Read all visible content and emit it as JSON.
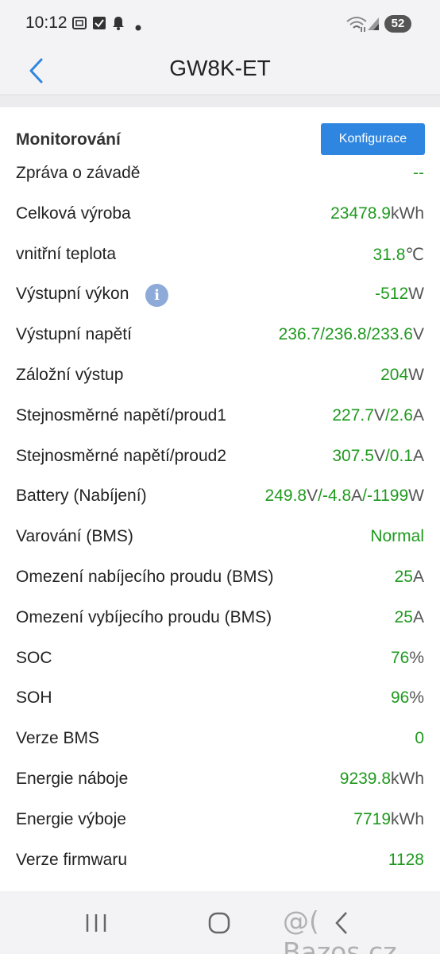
{
  "status_bar": {
    "time": "10:12",
    "battery": "52",
    "icons": [
      "screenshot-icon",
      "checkbox-icon",
      "bell-icon",
      "dot-icon",
      "wifi-icon",
      "signal-icon"
    ]
  },
  "header": {
    "title": "GW8K-ET",
    "back_icon": "chevron-left-icon"
  },
  "section": {
    "title": "Monitorování",
    "config_button": "Konfigurace"
  },
  "rows": [
    {
      "label": "Zpráva o závadě",
      "value": "--",
      "unit": ""
    },
    {
      "label": "Celková výroba",
      "value": "23478.9",
      "unit": "kWh"
    },
    {
      "label": "vnitřní teplota",
      "value": "31.8",
      "unit": "℃"
    },
    {
      "label": "Výstupní výkon",
      "value": "-512",
      "unit": "W",
      "info_icon": "i"
    },
    {
      "label": "Výstupní napětí",
      "value": "236.7/236.8/233.6",
      "unit": "V"
    },
    {
      "label": "Záložní výstup",
      "value": "204",
      "unit": "W"
    },
    {
      "label": "Stejnosměrné napětí/proud1",
      "value": "227.7",
      "unit": "V",
      "value2": "/2.6",
      "unit2": "A"
    },
    {
      "label": "Stejnosměrné napětí/proud2",
      "value": "307.5",
      "unit": "V",
      "value2": "/0.1",
      "unit2": "A"
    },
    {
      "label": "Battery (Nabíjení)",
      "value": "249.8",
      "unit": "V",
      "value2": "/-4.8",
      "unit2": "A",
      "value3": "/-1199",
      "unit3": "W"
    },
    {
      "label": "Varování (BMS)",
      "value": "Normal",
      "unit": ""
    },
    {
      "label": "Omezení nabíjecího proudu (BMS)",
      "value": "25",
      "unit": "A"
    },
    {
      "label": "Omezení vybíjecího proudu (BMS)",
      "value": "25",
      "unit": "A"
    },
    {
      "label": "SOC",
      "value": "76",
      "unit": "%"
    },
    {
      "label": "SOH",
      "value": "96",
      "unit": "%"
    },
    {
      "label": "Verze BMS",
      "value": "0",
      "unit": ""
    },
    {
      "label": "Energie náboje",
      "value": "9239.8",
      "unit": "kWh"
    },
    {
      "label": "Energie výboje",
      "value": "7719",
      "unit": "kWh"
    },
    {
      "label": "Verze firmwaru",
      "value": "1128",
      "unit": ""
    }
  ],
  "nav_bar": {
    "recents_icon": "recents-icon",
    "home_icon": "home-icon",
    "back_icon": "back-icon",
    "watermark": "@( Bazos.cz"
  },
  "colors": {
    "value_green": "#1f9a1f",
    "button_blue": "#2f86e0",
    "info_icon": "#8eaad8",
    "back_arrow": "#2f86e0"
  }
}
